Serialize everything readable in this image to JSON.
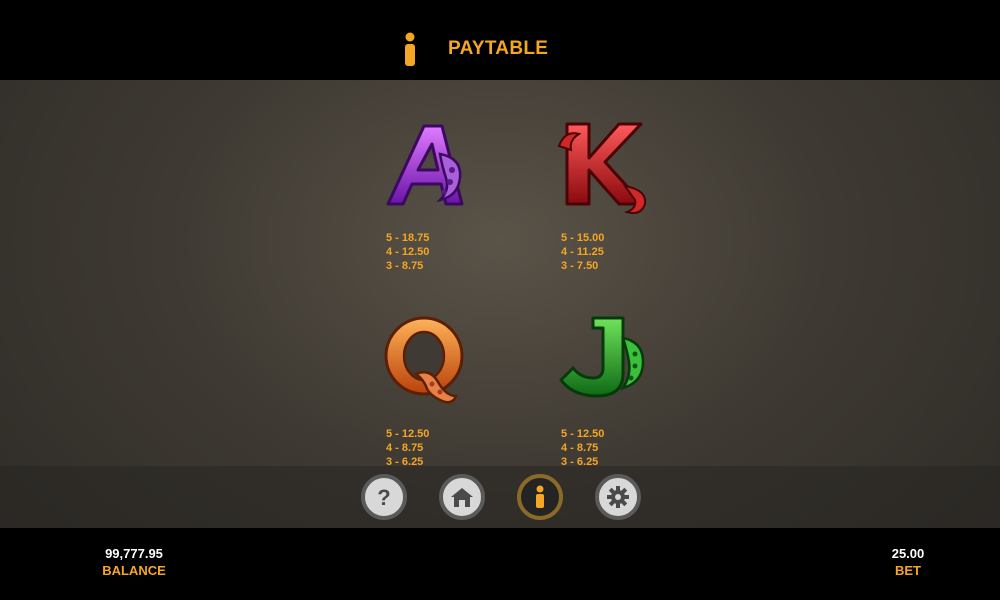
{
  "header": {
    "title": "PAYTABLE",
    "icon": "info-icon",
    "accent_color": "#f5a623"
  },
  "symbols": [
    {
      "name": "A",
      "color": "#9b2fd6",
      "pays": [
        "5 - 18.75",
        "4 - 12.50",
        "3 - 8.75"
      ]
    },
    {
      "name": "K",
      "color": "#c8191e",
      "pays": [
        "5 - 15.00",
        "4 - 11.25",
        "3 - 7.50"
      ]
    },
    {
      "name": "Q",
      "color": "#e8731a",
      "pays": [
        "5 - 12.50",
        "4 - 8.75",
        "3 - 6.25"
      ]
    },
    {
      "name": "J",
      "color": "#1fa52a",
      "pays": [
        "5 - 12.50",
        "4 - 8.75",
        "3 - 6.25"
      ]
    }
  ],
  "controls": [
    {
      "icon": "question-icon",
      "active": false
    },
    {
      "icon": "home-icon",
      "active": false
    },
    {
      "icon": "info-icon",
      "active": true
    },
    {
      "icon": "gear-icon",
      "active": false
    }
  ],
  "footer": {
    "balance_value": "99,777.95",
    "balance_label": "BALANCE",
    "bet_value": "25.00",
    "bet_label": "BET"
  }
}
